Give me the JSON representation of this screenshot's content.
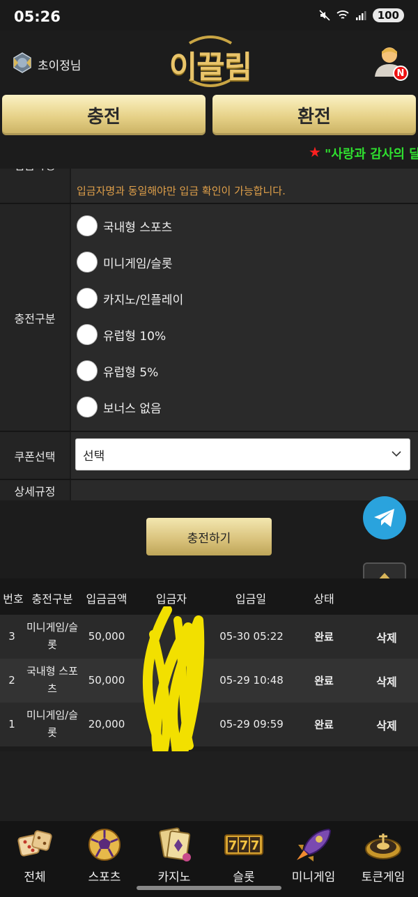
{
  "status_bar": {
    "time": "05:26",
    "battery": "100"
  },
  "header": {
    "username": "초이정님",
    "logo": "이끌림",
    "badge": "N"
  },
  "actions": {
    "charge": "충전",
    "exchange": "환전"
  },
  "marquee": {
    "star": "★",
    "text": "\"사랑과 감사의 달"
  },
  "form": {
    "depositor_label": "입금자명",
    "depositor_notice": "입금자명과 동일해야만 입금 확인이 가능합니다.",
    "type_label": "충전구분",
    "types": [
      "국내형 스포츠",
      "미니게임/슬롯",
      "카지노/인플레이",
      "유럽형 10%",
      "유럽형 5%",
      "보너스 없음"
    ],
    "coupon_label": "쿠폰선택",
    "coupon_selected": "선택",
    "rules_label": "상세규정",
    "submit": "충전하기"
  },
  "table": {
    "headers": [
      "번호",
      "충전구분",
      "입금금액",
      "입금자",
      "입금일",
      "상태"
    ],
    "rows": [
      {
        "no": "3",
        "type": "미니게임/슬롯",
        "amount": "50,000",
        "date": "05-30 05:22",
        "status": "완료",
        "action": "삭제"
      },
      {
        "no": "2",
        "type": "국내형 스포츠",
        "amount": "50,000",
        "date": "05-29 10:48",
        "status": "완료",
        "action": "삭제"
      },
      {
        "no": "1",
        "type": "미니게임/슬롯",
        "amount": "20,000",
        "date": "05-29 09:59",
        "status": "완료",
        "action": "삭제"
      }
    ]
  },
  "bottom_nav": [
    {
      "label": "전체",
      "icon": "dice-icon"
    },
    {
      "label": "스포츠",
      "icon": "soccer-ball-icon"
    },
    {
      "label": "카지노",
      "icon": "casino-cards-icon"
    },
    {
      "label": "슬롯",
      "icon": "slot-777-icon"
    },
    {
      "label": "미니게임",
      "icon": "rocket-icon"
    },
    {
      "label": "토큰게임",
      "icon": "roulette-icon"
    }
  ],
  "colors": {
    "gold": "#e6d187",
    "notice": "#e0a04a",
    "marquee": "#2fe02f",
    "telegram": "#2aa3dd"
  }
}
